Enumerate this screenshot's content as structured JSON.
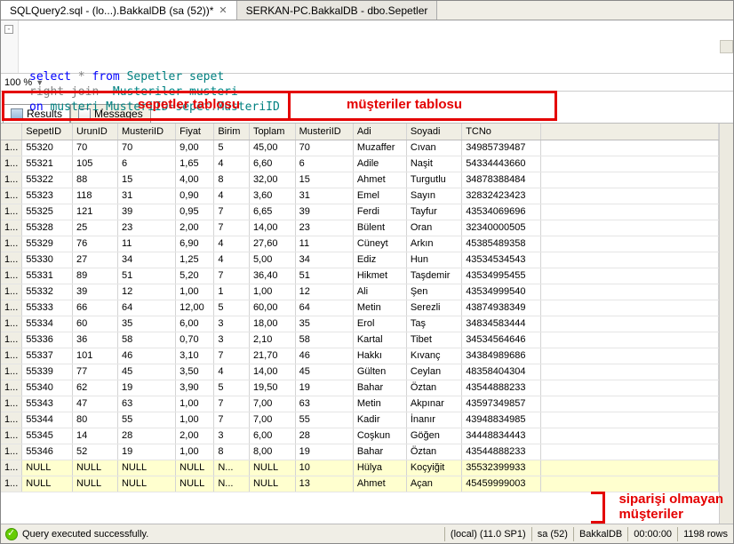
{
  "tabs": {
    "active": "SQLQuery2.sql - (lo...).BakkalDB (sa (52))*",
    "inactive": "SERKAN-PC.BakkalDB - dbo.Sepetler"
  },
  "sql": {
    "l1a": "select",
    "l1b": " * ",
    "l1c": "from",
    "l1d": " Sepetler sepet",
    "l2a": "right",
    "l2b": " join",
    "l2c": "  Musteriler musteri",
    "l3a": "on",
    "l3b": " musteri",
    "l3c": ".",
    "l3d": "MusteriID",
    "l3e": "=",
    "l3f": "sepet",
    "l3g": ".",
    "l3h": "MusteriID"
  },
  "zoom": "100 %",
  "annotations": {
    "sepetler": "sepetler tablosu",
    "musteriler": "müşteriler tablosu",
    "side1": "siparişi olmayan",
    "side2": "müşteriler"
  },
  "resultTabs": {
    "results": "Results",
    "messages": "Messages"
  },
  "columns": [
    "",
    "SepetID",
    "UrunID",
    "MusteriID",
    "Fiyat",
    "Birim",
    "Toplam",
    "MusteriID",
    "Adi",
    "Soyadi",
    "TCNo"
  ],
  "rows": [
    [
      "1...",
      "55320",
      "70",
      "70",
      "9,00",
      "5",
      "45,00",
      "70",
      "Muzaffer",
      "Cıvan",
      "34985739487"
    ],
    [
      "1...",
      "55321",
      "105",
      "6",
      "1,65",
      "4",
      "6,60",
      "6",
      "Adile",
      "Naşit",
      "54334443660"
    ],
    [
      "1...",
      "55322",
      "88",
      "15",
      "4,00",
      "8",
      "32,00",
      "15",
      "Ahmet",
      "Turgutlu",
      "34878388484"
    ],
    [
      "1...",
      "55323",
      "118",
      "31",
      "0,90",
      "4",
      "3,60",
      "31",
      "Emel",
      "Sayın",
      "32832423423"
    ],
    [
      "1...",
      "55325",
      "121",
      "39",
      "0,95",
      "7",
      "6,65",
      "39",
      "Ferdi",
      "Tayfur",
      "43534069696"
    ],
    [
      "1...",
      "55328",
      "25",
      "23",
      "2,00",
      "7",
      "14,00",
      "23",
      "Bülent",
      "Oran",
      "32340000505"
    ],
    [
      "1...",
      "55329",
      "76",
      "11",
      "6,90",
      "4",
      "27,60",
      "11",
      "Cüneyt",
      "Arkın",
      "45385489358"
    ],
    [
      "1...",
      "55330",
      "27",
      "34",
      "1,25",
      "4",
      "5,00",
      "34",
      "Ediz",
      "Hun",
      "43534534543"
    ],
    [
      "1...",
      "55331",
      "89",
      "51",
      "5,20",
      "7",
      "36,40",
      "51",
      "Hikmet",
      "Taşdemir",
      "43534995455"
    ],
    [
      "1...",
      "55332",
      "39",
      "12",
      "1,00",
      "1",
      "1,00",
      "12",
      "Ali",
      "Şen",
      "43534999540"
    ],
    [
      "1...",
      "55333",
      "66",
      "64",
      "12,00",
      "5",
      "60,00",
      "64",
      "Metin",
      "Serezli",
      "43874938349"
    ],
    [
      "1...",
      "55334",
      "60",
      "35",
      "6,00",
      "3",
      "18,00",
      "35",
      "Erol",
      "Taş",
      "34834583444"
    ],
    [
      "1...",
      "55336",
      "36",
      "58",
      "0,70",
      "3",
      "2,10",
      "58",
      "Kartal",
      "Tibet",
      "34534564646"
    ],
    [
      "1...",
      "55337",
      "101",
      "46",
      "3,10",
      "7",
      "21,70",
      "46",
      "Hakkı",
      "Kıvanç",
      "34384989686"
    ],
    [
      "1...",
      "55339",
      "77",
      "45",
      "3,50",
      "4",
      "14,00",
      "45",
      "Gülten",
      "Ceylan",
      "48358404304"
    ],
    [
      "1...",
      "55340",
      "62",
      "19",
      "3,90",
      "5",
      "19,50",
      "19",
      "Bahar",
      "Öztan",
      "43544888233"
    ],
    [
      "1...",
      "55343",
      "47",
      "63",
      "1,00",
      "7",
      "7,00",
      "63",
      "Metin",
      "Akpınar",
      "43597349857"
    ],
    [
      "1...",
      "55344",
      "80",
      "55",
      "1,00",
      "7",
      "7,00",
      "55",
      "Kadir",
      "İnanır",
      "43948834985"
    ],
    [
      "1...",
      "55345",
      "14",
      "28",
      "2,00",
      "3",
      "6,00",
      "28",
      "Coşkun",
      "Göğen",
      "34448834443"
    ],
    [
      "1...",
      "55346",
      "52",
      "19",
      "1,00",
      "8",
      "8,00",
      "19",
      "Bahar",
      "Öztan",
      "43544888233"
    ],
    [
      "1...",
      "NULL",
      "NULL",
      "NULL",
      "NULL",
      "N...",
      "NULL",
      "10",
      "Hülya",
      "Koçyiğit",
      "35532399933"
    ],
    [
      "1...",
      "NULL",
      "NULL",
      "NULL",
      "NULL",
      "N...",
      "NULL",
      "13",
      "Ahmet",
      "Açan",
      "45459999003"
    ]
  ],
  "status": {
    "msg": "Query executed successfully.",
    "server": "(local) (11.0 SP1)",
    "user": "sa (52)",
    "db": "BakkalDB",
    "time": "00:00:00",
    "rows": "1198 rows"
  }
}
